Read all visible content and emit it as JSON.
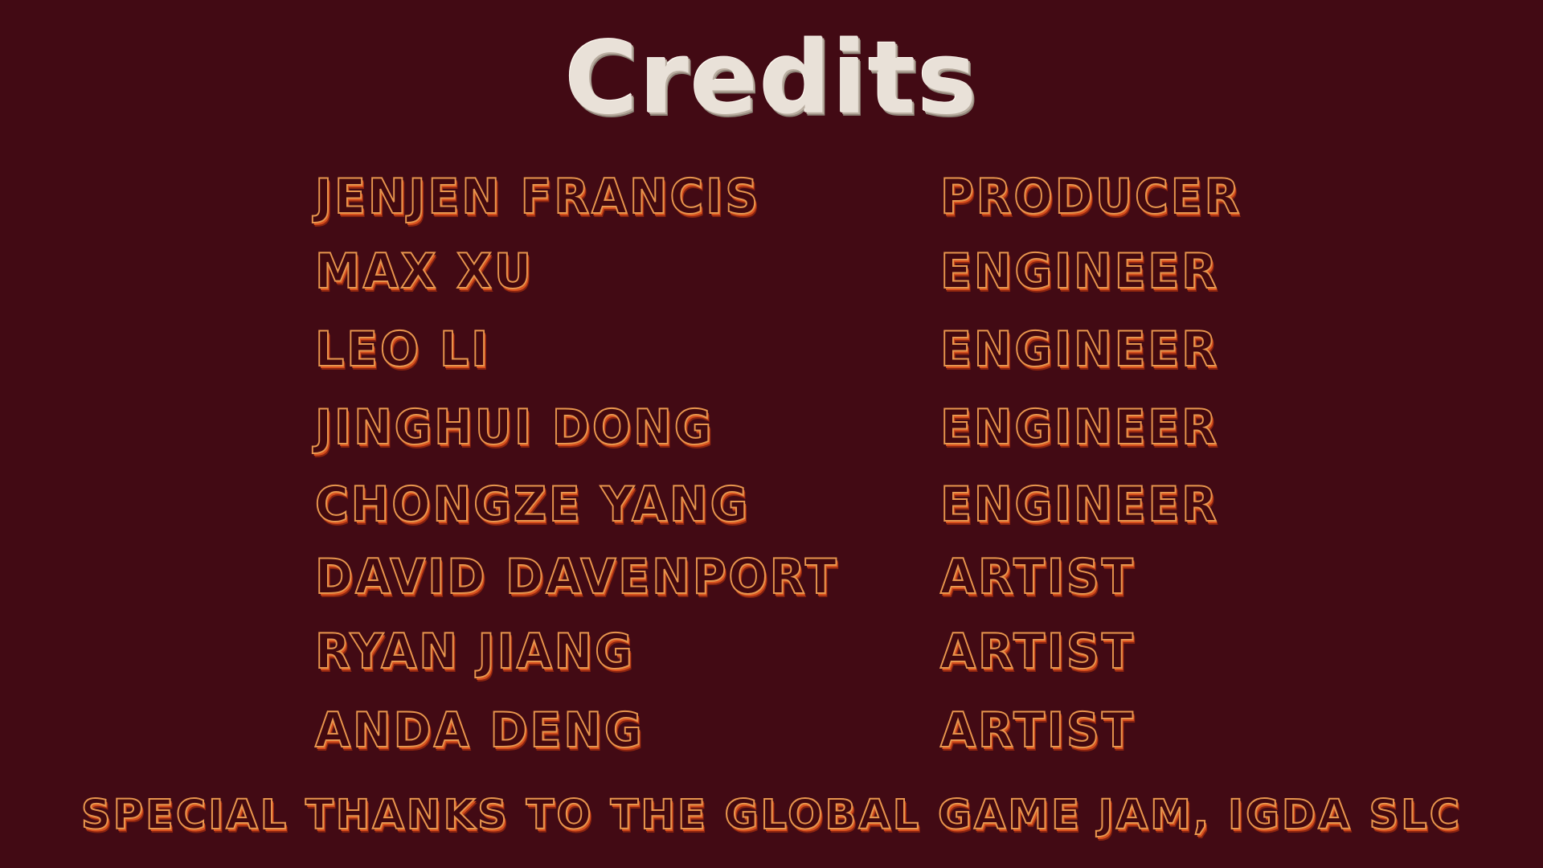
{
  "title": "Credits",
  "credits": [
    {
      "name": "Jenjen Francis",
      "role": "Producer"
    },
    {
      "name": "Max Xu",
      "role": "Engineer"
    },
    {
      "name": "Leo Li",
      "role": "Engineer"
    },
    {
      "name": "Jinghui Dong",
      "role": "Engineer"
    },
    {
      "name": "Chongze Yang",
      "role": "Engineer"
    },
    {
      "name": "David Davenport",
      "role": "Artist"
    },
    {
      "name": "Ryan Jiang",
      "role": "Artist"
    },
    {
      "name": "Anda Deng",
      "role": "Artist"
    }
  ],
  "special_thanks": "Special thanks to the Global Game Jam, IGDA SLC",
  "colors": {
    "background": "#420a14",
    "title": "#e9e1d8",
    "text_outline": "#e8964e",
    "text_shadow": "#d8501e"
  }
}
